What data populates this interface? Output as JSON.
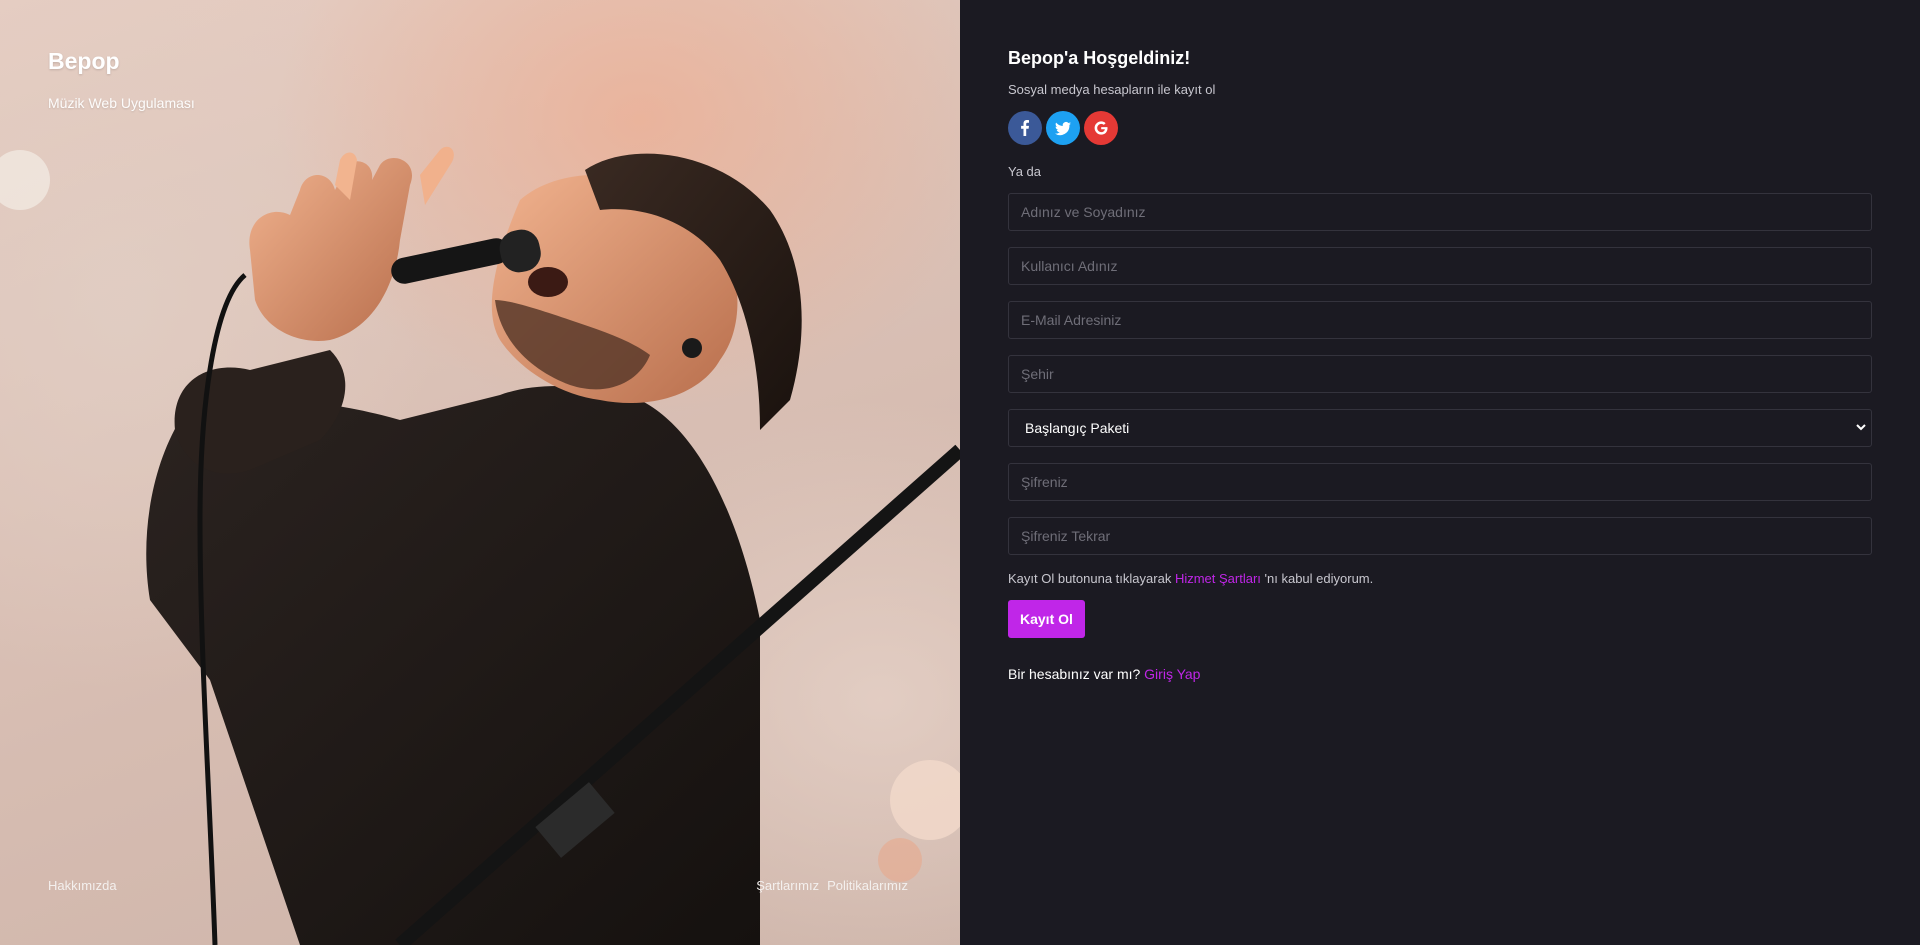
{
  "hero": {
    "title": "Bepop",
    "subtitle": "Müzik Web Uygulaması",
    "image": "singer-with-microphone-photo",
    "footer": {
      "about": "Hakkımızda",
      "terms": "Şartlarımız",
      "policies": "Politikalarımız"
    }
  },
  "form": {
    "welcome": "Bepop'a Hoşgeldiniz!",
    "social_text": "Sosyal medya hesapların ile kayıt ol",
    "socials": [
      {
        "name": "facebook-icon",
        "color": "#3b5998"
      },
      {
        "name": "twitter-icon",
        "color": "#1da1f2"
      },
      {
        "name": "google-icon",
        "color": "#e53935"
      }
    ],
    "or_text": "Ya da",
    "fields": {
      "fullname_placeholder": "Adınız ve Soyadınız",
      "username_placeholder": "Kullanıcı Adınız",
      "email_placeholder": "E-Mail Adresiniz",
      "city_placeholder": "Şehir",
      "package_selected": "Başlangıç Paketi",
      "password_placeholder": "Şifreniz",
      "password_repeat_placeholder": "Şifreniz Tekrar"
    },
    "terms_prefix": "Kayıt Ol butonuna tıklayarak",
    "terms_link": "Hizmet Şartları",
    "terms_suffix": "'nı kabul ediyorum.",
    "submit_label": "Kayıt Ol",
    "have_account": "Bir hesabınız var mı?",
    "login_link": "Giriş Yap"
  },
  "colors": {
    "accent": "#c026e8",
    "panel_bg": "#1b1a22",
    "input_border": "#34333d"
  }
}
